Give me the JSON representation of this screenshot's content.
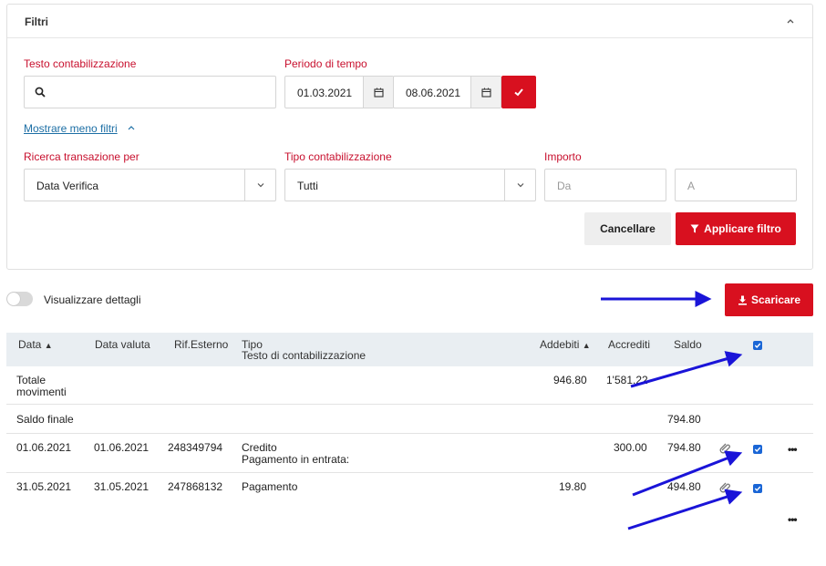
{
  "filters": {
    "title": "Filtri",
    "booking_text_label": "Testo contabilizzazione",
    "period_label": "Periodo di tempo",
    "date_from": "01.03.2021",
    "date_to": "08.06.2021",
    "less_filters_link": "Mostrare meno filtri",
    "search_by_label": "Ricerca transazione per",
    "search_by_value": "Data Verifica",
    "booking_type_label": "Tipo contabilizzazione",
    "booking_type_value": "Tutti",
    "amount_label": "Importo",
    "amount_from_placeholder": "Da",
    "amount_to_placeholder": "A",
    "cancel_label": "Cancellare",
    "apply_label": "Applicare filtro"
  },
  "toolbar": {
    "details_toggle_label": "Visualizzare dettagli",
    "download_label": "Scaricare"
  },
  "table": {
    "headers": {
      "date": "Data",
      "value_date": "Data valuta",
      "ext_ref": "Rif.Esterno",
      "type": "Tipo",
      "type_sub": "Testo di contabilizzazione",
      "debits": "Addebiti",
      "credits": "Accrediti",
      "balance": "Saldo"
    },
    "total_row": {
      "label_line1": "Totale",
      "label_line2": "movimenti",
      "debits": "946.80",
      "credits": "1'581.22"
    },
    "final_balance_row": {
      "label": "Saldo finale",
      "balance": "794.80"
    },
    "rows": [
      {
        "date": "01.06.2021",
        "value_date": "01.06.2021",
        "ext_ref": "248349794",
        "type": "Credito",
        "type_sub": "Pagamento in entrata:",
        "debits": "",
        "credits": "300.00",
        "balance": "794.80"
      },
      {
        "date": "31.05.2021",
        "value_date": "31.05.2021",
        "ext_ref": "247868132",
        "type": "Pagamento",
        "type_sub": "",
        "debits": "19.80",
        "credits": "",
        "balance": "494.80"
      }
    ]
  },
  "colors": {
    "accent_red": "#d8101f",
    "label_red": "#c8102e",
    "annotation_blue": "#1a14d8",
    "checkbox_blue": "#1a66d6"
  },
  "icons": [
    "chevron-up-icon",
    "search-icon",
    "calendar-icon",
    "checkmark-icon",
    "chevron-down-icon",
    "filter-icon",
    "download-icon",
    "sort-icon",
    "paperclip-icon",
    "more-icon",
    "annotation-arrow"
  ]
}
